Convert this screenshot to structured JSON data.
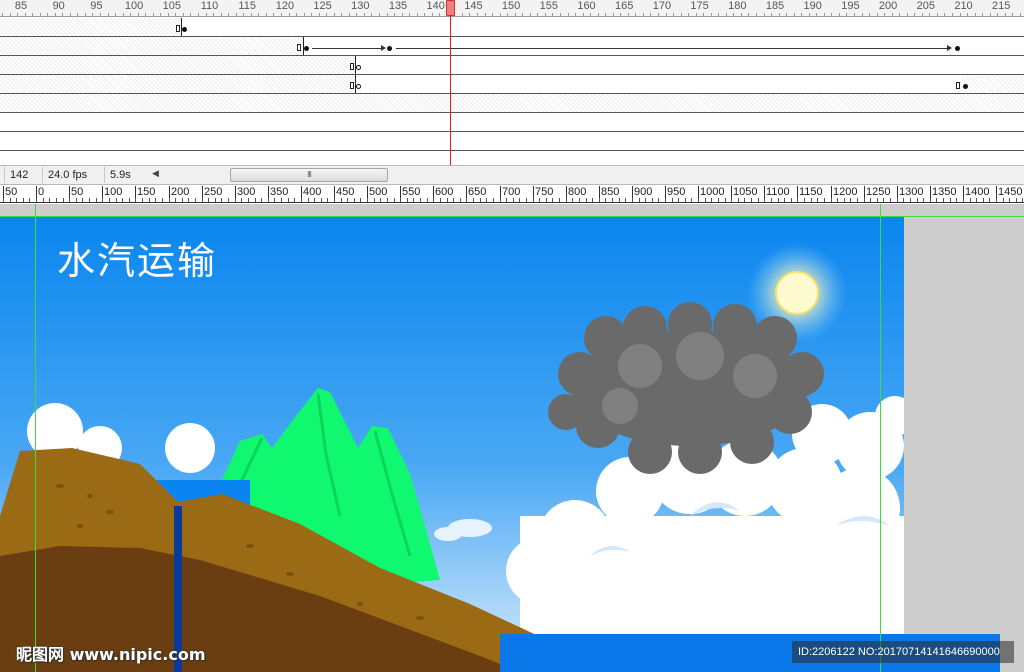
{
  "timeline": {
    "frame_ticks": [
      "85",
      "90",
      "95",
      "100",
      "105",
      "110",
      "115",
      "120",
      "125",
      "130",
      "135",
      "140",
      "145",
      "150",
      "155",
      "160",
      "165",
      "170",
      "175",
      "180",
      "185",
      "190",
      "195",
      "200",
      "205",
      "210",
      "215"
    ],
    "current_frame": "142"
  },
  "status": {
    "frame": "142",
    "fps": "24.0 fps",
    "time": "5.9s",
    "scroll_left_icon": "arrow-left-icon",
    "scroll_thumb_grip": "III"
  },
  "stage_ruler": {
    "ticks": [
      "50",
      "0",
      "50",
      "100",
      "150",
      "200",
      "250",
      "300",
      "350",
      "400",
      "450",
      "500",
      "550",
      "600",
      "650",
      "700",
      "750",
      "800",
      "850",
      "900",
      "950",
      "1000",
      "1050",
      "1100",
      "1150",
      "1200",
      "1250",
      "1300",
      "1350",
      "1400",
      "1450"
    ]
  },
  "stage": {
    "title": "水汽运输",
    "colors": {
      "sky_top": "#0a86ee",
      "sky_bottom": "#d8ecfb",
      "mountain": "#10f870",
      "earth_top": "#9a6a14",
      "earth_deep": "#6a3e10",
      "cloud_dark": "#6a6a6a",
      "sun": "#fffbd0"
    }
  },
  "watermark": {
    "left": "昵图网 www.nipic.com",
    "right": "ID:2206122 NO:20170714141646690000"
  }
}
